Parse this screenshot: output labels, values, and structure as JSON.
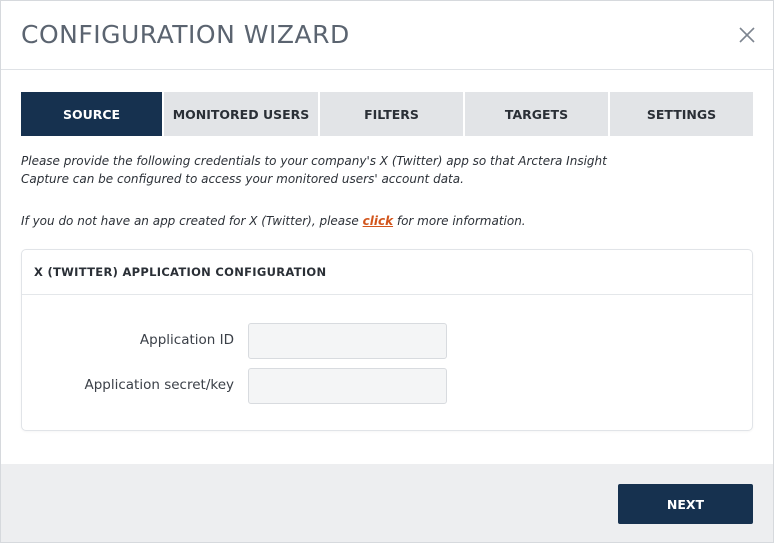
{
  "dialog": {
    "title": "CONFIGURATION WIZARD"
  },
  "tabs": [
    {
      "label": "SOURCE",
      "active": true
    },
    {
      "label": "MONITORED USERS",
      "active": false
    },
    {
      "label": "FILTERS",
      "active": false
    },
    {
      "label": "TARGETS",
      "active": false
    },
    {
      "label": "SETTINGS",
      "active": false
    }
  ],
  "intro": {
    "text": "Please provide the following credentials to your company's X (Twitter) app so that Arctera Insight Capture can be configured to access your monitored users' account data.",
    "help_prefix": "If you do not have an app created for X (Twitter), please ",
    "help_link": "click",
    "help_suffix": " for more information."
  },
  "panel": {
    "title": "X (TWITTER) APPLICATION CONFIGURATION",
    "fields": [
      {
        "label": "Application ID",
        "value": "",
        "placeholder": ""
      },
      {
        "label": "Application secret/key",
        "value": "",
        "placeholder": ""
      }
    ]
  },
  "footer": {
    "next_label": "NEXT"
  },
  "icons": {
    "close": "close-icon"
  },
  "colors": {
    "primary": "#16314f",
    "link": "#d2551c",
    "tab_inactive": "#e2e4e7",
    "footer_bg": "#edeef0"
  }
}
